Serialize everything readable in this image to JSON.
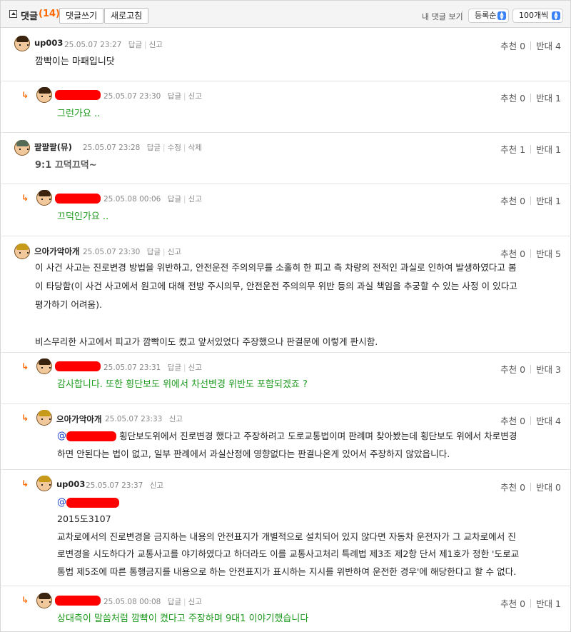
{
  "header": {
    "title": "댓글",
    "count": "(14)",
    "write_button": "댓글쓰기",
    "refresh_button": "새로고침",
    "my_comments_link": "내 댓글 보기",
    "sort_value": "등록순",
    "per_page_value": "100개씩"
  },
  "comments": [
    {
      "nick": "up003",
      "date": "25.05.07 23:27",
      "actions": [
        "답글",
        "신고"
      ],
      "up": "추천 0",
      "down": "반대 4",
      "lines": [
        "깜빡이는 마패입니닷"
      ]
    },
    {
      "nick": "",
      "date": "25.05.07 23:30",
      "actions": [
        "답글",
        "신고"
      ],
      "up": "추천 0",
      "down": "반대 1",
      "lines": [
        "그런가요 .."
      ]
    },
    {
      "nick": "팥팥팥(뮤)",
      "date": "25.05.07 23:28",
      "actions": [
        "답글",
        "수정",
        "삭제"
      ],
      "up": "추천 1",
      "down": "반대 1",
      "lines": [
        "9:1 끄덕끄덕~"
      ]
    },
    {
      "nick": "",
      "date": "25.05.08 00:06",
      "actions": [
        "답글",
        "신고"
      ],
      "up": "추천 0",
      "down": "반대 1",
      "lines": [
        "끄덕인가요 .."
      ]
    },
    {
      "nick": "으아가악아개",
      "date": "25.05.07 23:30",
      "actions": [
        "답글",
        "신고"
      ],
      "up": "추천 0",
      "down": "반대 5",
      "lines": [
        "이 사건 사고는 진로변경 방법을 위반하고, 안전운전 주의의무를 소홀히 한 피고 측 차량의 전적인 과실로 인하여 발생하였다고 봄",
        "이 타당함(이 사건 사고에서 원고에 대해 전방 주시의무, 안전운전 주의의무 위반 등의 과실 책임을 추궁할 수 있는 사정 이 있다고",
        "평가하기 어려움).",
        "",
        "비스무리한 사고에서 피고가 깜빡이도 켰고 앞서있었다 주장했으나 판결문에 이렇게 판시함."
      ]
    },
    {
      "nick": "",
      "date": "25.05.07 23:31",
      "actions": [
        "답글",
        "신고"
      ],
      "up": "추천 0",
      "down": "반대 3",
      "lines": [
        "감사합니다. 또한 횡단보도 위에서 차선변경 위반도 포함되겠죠 ?"
      ]
    },
    {
      "nick": "으아가악아개",
      "date": "25.05.07 23:33",
      "actions": [
        "신고"
      ],
      "up": "추천 0",
      "down": "반대 4",
      "mention": "@",
      "lines": [
        "횡단보도위에서 진로변경 했다고 주장하려고 도로교통법이며 판례며 찾아봤는데 횡단보도 위에서 차로변경",
        "하면 안된다는 법이 없고, 일부 판례에서 과실산정에 영향없다는 판결나온게 있어서 주장하지 않았읍니다."
      ]
    },
    {
      "nick": "up003",
      "date": "25.05.07 23:37",
      "actions": [
        "신고"
      ],
      "up": "추천 0",
      "down": "반대 0",
      "mention": "@",
      "lines": [
        "2015도3107",
        "교차로에서의 진로변경을 금지하는 내용의 안전표지가 개별적으로 설치되어 있지 않다면 자동차 운전자가 그 교차로에서 진",
        "로변경을 시도하다가 교통사고를 야기하였다고 하더라도 이를 교통사고처리 특례법 제3조 제2항 단서 제1호가 정한 '도로교",
        "통법 제5조에 따른 통행금지를 내용으로 하는 안전표지가 표시하는 지시를 위반하여 운전한 경우'에 해당한다고 할 수 없다."
      ]
    },
    {
      "nick": "",
      "date": "25.05.08 00:08",
      "actions": [
        "답글",
        "신고"
      ],
      "up": "추천 0",
      "down": "반대 1",
      "lines": [
        "상대측이 말씀처럼 깜빡이 켰다고 주장하며 9대1 이야기했습니다"
      ]
    }
  ]
}
